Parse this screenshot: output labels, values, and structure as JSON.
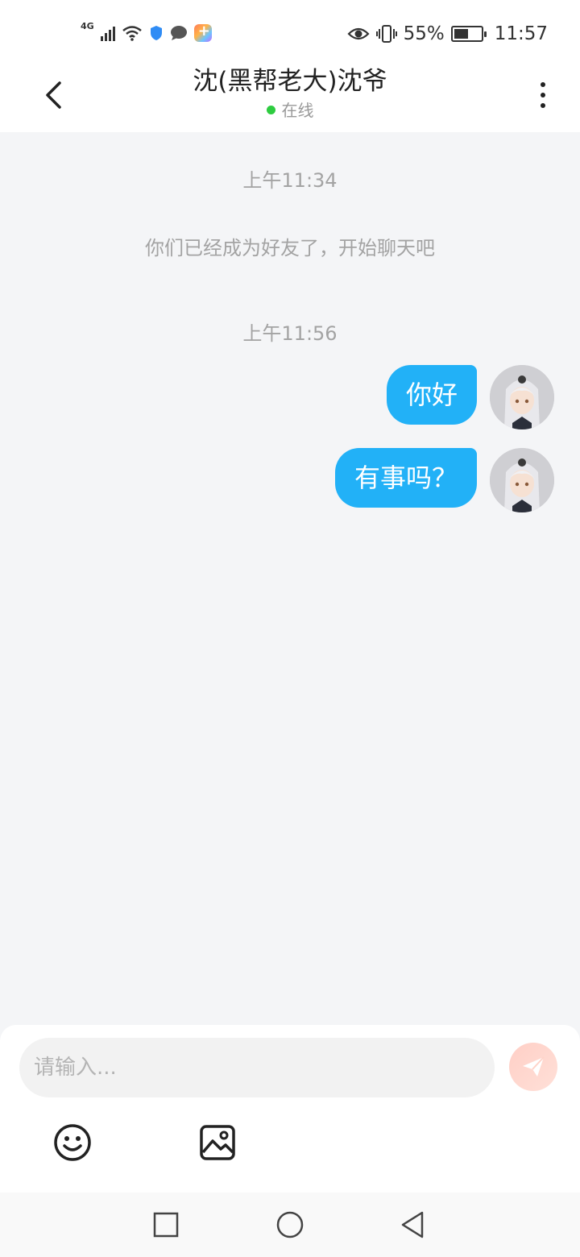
{
  "status_bar": {
    "network": "4G",
    "battery_percent": "55%",
    "time": "11:57",
    "battery_level": 0.55
  },
  "header": {
    "title": "沈(黑帮老大)沈爷",
    "status": "在线",
    "status_color": "#2ecc40"
  },
  "chat": {
    "timestamps": [
      "上午11:34",
      "上午11:56"
    ],
    "system_message": "你们已经成为好友了，开始聊天吧",
    "messages": [
      {
        "text": "你好",
        "from": "me"
      },
      {
        "text": "有事吗？",
        "from": "me"
      }
    ],
    "bubble_color": "#22b1f7"
  },
  "input": {
    "placeholder": "请输入...",
    "value": ""
  },
  "icons": {
    "back": "chevron-left-icon",
    "more": "more-vertical-icon",
    "send": "paper-plane-icon",
    "emoji": "smiley-icon",
    "image": "image-icon",
    "nav_recent": "square-icon",
    "nav_home": "circle-icon",
    "nav_back": "triangle-back-icon"
  }
}
